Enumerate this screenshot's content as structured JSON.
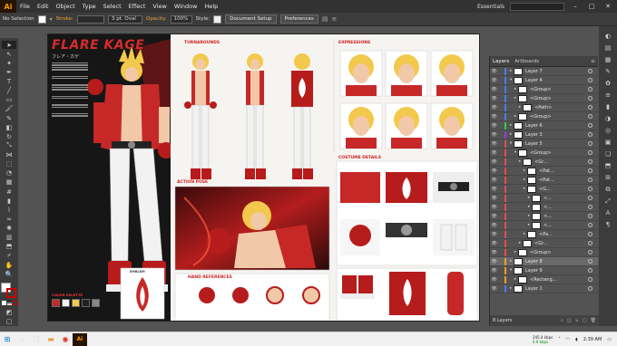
{
  "app": {
    "logo": "Ai"
  },
  "menu": [
    "File",
    "Edit",
    "Object",
    "Type",
    "Select",
    "Effect",
    "View",
    "Window",
    "Help"
  ],
  "workspace": "Essentials",
  "control_bar": {
    "selection": "No Selection",
    "stroke_label": "Stroke:",
    "brush": "3 pt. Oval",
    "opacity_label": "Opacity:",
    "opacity_value": "100%",
    "style_label": "Style:",
    "doc_setup": "Document Setup",
    "preferences": "Preferences"
  },
  "sheet": {
    "title": "FLARE KAGE",
    "subtitle": "フレア・カゲ",
    "sections": {
      "turnarounds": "TURNAROUNDS",
      "expressions": "EXPRESSIONS",
      "action_pose": "ACTION POSE",
      "costume_details": "COSTUME DETAILS",
      "hand_references": "HAND REFERENCES",
      "color_palette": "COLOR PALETTE",
      "emblem": "EMBLEM"
    }
  },
  "layers_panel": {
    "tabs": [
      "Layers",
      "Artboards"
    ],
    "rows": [
      {
        "name": "Layer 7",
        "color": "#4a7bff",
        "indent": 0,
        "expanded": false
      },
      {
        "name": "Layer 4",
        "color": "#4a7bff",
        "indent": 0,
        "expanded": true
      },
      {
        "name": "<Group>",
        "color": "#4a7bff",
        "indent": 1,
        "expanded": false
      },
      {
        "name": "<Group>",
        "color": "#4a7bff",
        "indent": 1,
        "expanded": false
      },
      {
        "name": "<Path>",
        "color": "#4a7bff",
        "indent": 2,
        "expanded": false
      },
      {
        "name": "<Group>",
        "color": "#4a7bff",
        "indent": 1,
        "expanded": false
      },
      {
        "name": "Layer 6",
        "color": "#2bd14e",
        "indent": 0,
        "expanded": false
      },
      {
        "name": "Layer 3",
        "color": "#9c3bd6",
        "indent": 0,
        "expanded": false
      },
      {
        "name": "Layer 5",
        "color": "#e84c4c",
        "indent": 0,
        "expanded": true
      },
      {
        "name": "<Group>",
        "color": "#e84c4c",
        "indent": 1,
        "expanded": true
      },
      {
        "name": "<Gr...",
        "color": "#e84c4c",
        "indent": 2,
        "expanded": false
      },
      {
        "name": "<Pat...",
        "color": "#e84c4c",
        "indent": 3,
        "expanded": false
      },
      {
        "name": "<Pat...",
        "color": "#e84c4c",
        "indent": 3,
        "expanded": false
      },
      {
        "name": "<G...",
        "color": "#e84c4c",
        "indent": 3,
        "expanded": false
      },
      {
        "name": "<...",
        "color": "#e84c4c",
        "indent": 4,
        "expanded": false
      },
      {
        "name": "<...",
        "color": "#e84c4c",
        "indent": 4,
        "expanded": false
      },
      {
        "name": "<...",
        "color": "#e84c4c",
        "indent": 4,
        "expanded": false
      },
      {
        "name": "<...",
        "color": "#e84c4c",
        "indent": 4,
        "expanded": false
      },
      {
        "name": "<Pa...",
        "color": "#e84c4c",
        "indent": 3,
        "expanded": false
      },
      {
        "name": "<Gr...",
        "color": "#e84c4c",
        "indent": 2,
        "expanded": false
      },
      {
        "name": "<Group>",
        "color": "#e84c4c",
        "indent": 1,
        "expanded": false
      },
      {
        "name": "Layer 8",
        "color": "#f0a020",
        "indent": 0,
        "expanded": false,
        "selected": true
      },
      {
        "name": "Layer 9",
        "color": "#f0a020",
        "indent": 0,
        "expanded": true
      },
      {
        "name": "<Rectang...",
        "color": "#f0a020",
        "indent": 1,
        "expanded": false
      },
      {
        "name": "Layer 1",
        "color": "#4a7bff",
        "indent": 0,
        "expanded": false
      }
    ],
    "footer": "8 Layers"
  },
  "taskbar": {
    "net_up": "245.4 kbps",
    "net_down": "4.9 kbps",
    "time": "2:39 AM"
  },
  "colors": {
    "accent_red": "#c62828",
    "hair": "#f2c94c",
    "dark": "#1a1a1a"
  }
}
